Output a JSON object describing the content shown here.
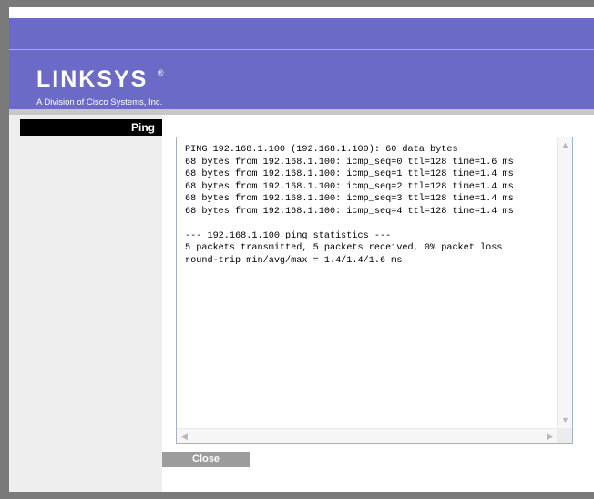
{
  "header": {
    "logo": "LINKSYS",
    "logo_mark": "®",
    "tagline": "A Division of Cisco Systems, Inc."
  },
  "sidebar": {
    "title": "Ping"
  },
  "output": {
    "text": "PING 192.168.1.100 (192.168.1.100): 60 data bytes\n68 bytes from 192.168.1.100: icmp_seq=0 ttl=128 time=1.6 ms\n68 bytes from 192.168.1.100: icmp_seq=1 ttl=128 time=1.4 ms\n68 bytes from 192.168.1.100: icmp_seq=2 ttl=128 time=1.4 ms\n68 bytes from 192.168.1.100: icmp_seq=3 ttl=128 time=1.4 ms\n68 bytes from 192.168.1.100: icmp_seq=4 ttl=128 time=1.4 ms\n\n--- 192.168.1.100 ping statistics ---\n5 packets transmitted, 5 packets received, 0% packet loss\nround-trip min/avg/max = 1.4/1.4/1.6 ms"
  },
  "buttons": {
    "close": "Close"
  },
  "colors": {
    "header": "#6b6bc7",
    "sidebar": "#eeeeee",
    "title_bar": "#000000",
    "button": "#9c9c9c"
  }
}
